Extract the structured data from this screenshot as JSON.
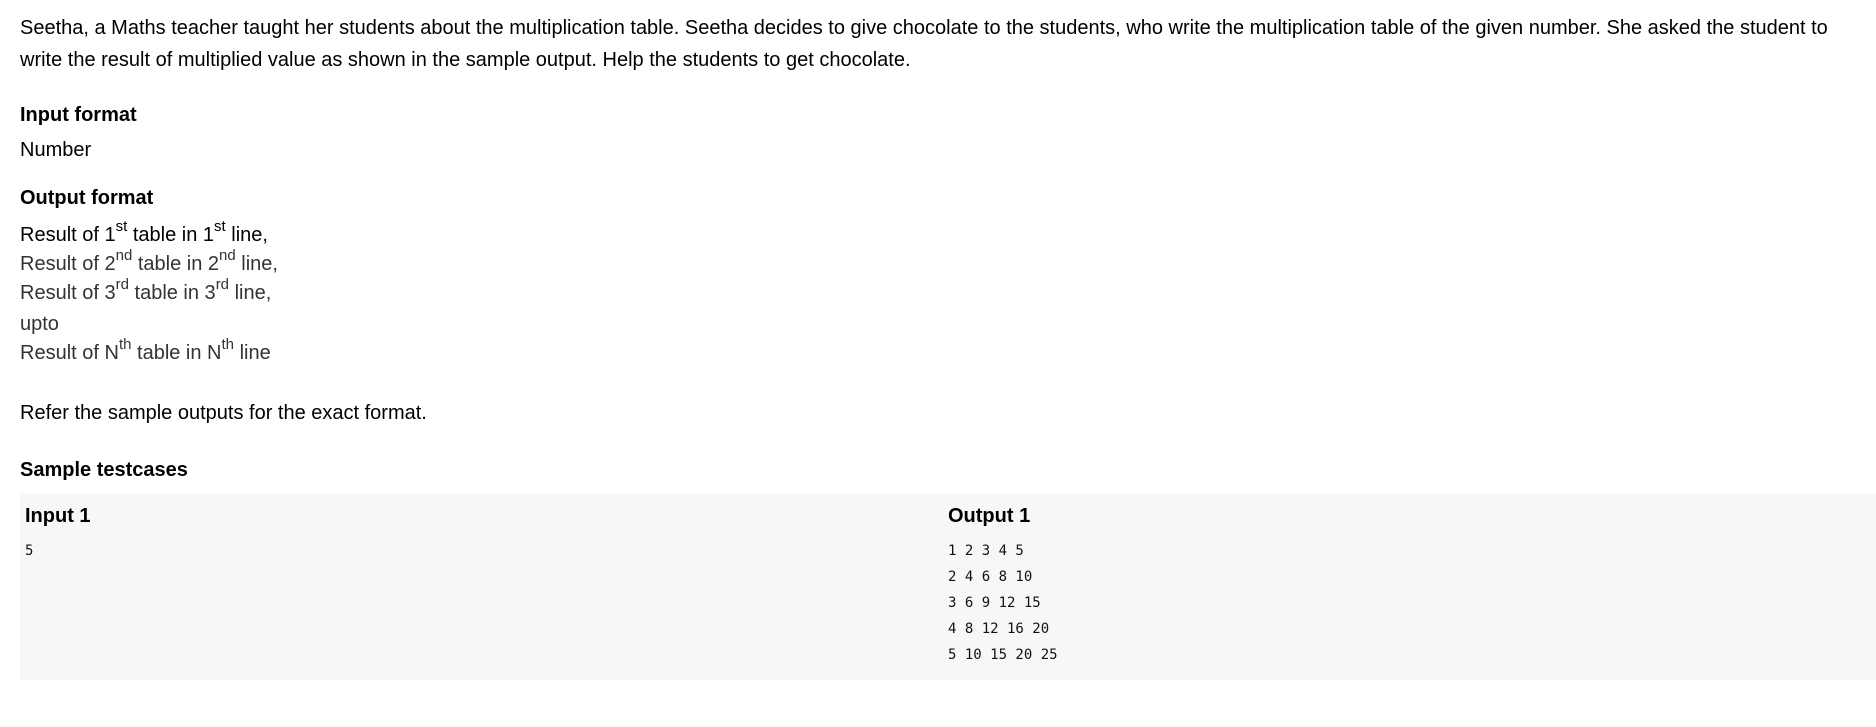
{
  "problem": {
    "intro": "Seetha, a Maths teacher taught her students about the multiplication table. Seetha decides to give chocolate to the students, who write the multiplication table of the given number. She asked the student to write the result of multiplied value as shown in the sample output. Help the students to get chocolate.",
    "input_format_title": "Input format",
    "input_format_text": "Number",
    "output_format_title": "Output format",
    "output_lines": [
      {
        "pre": "Result of 1",
        "sup1": "st",
        "mid": " table in 1",
        "sup2": "st",
        "post": " line,"
      },
      {
        "pre": "Result of 2",
        "sup1": "nd",
        "mid": " table in 2",
        "sup2": "nd",
        "post": " line,"
      },
      {
        "pre": "Result of 3",
        "sup1": "rd",
        "mid": " table in 3",
        "sup2": "rd",
        "post": " line,"
      },
      {
        "text": "upto"
      },
      {
        "pre": "Result of N",
        "sup1": "th",
        "mid": " table in N",
        "sup2": "th",
        "post": " line"
      }
    ],
    "refer_text": "Refer the sample outputs for the exact format.",
    "sample_title": "Sample testcases"
  },
  "testcase": {
    "input_label": "Input 1",
    "input_value": "5",
    "output_label": "Output 1",
    "output_lines": [
      "1 2 3 4 5",
      "2 4 6 8 10",
      "3 6 9 12 15",
      "4 8 12 16 20",
      "5 10 15 20 25"
    ]
  }
}
